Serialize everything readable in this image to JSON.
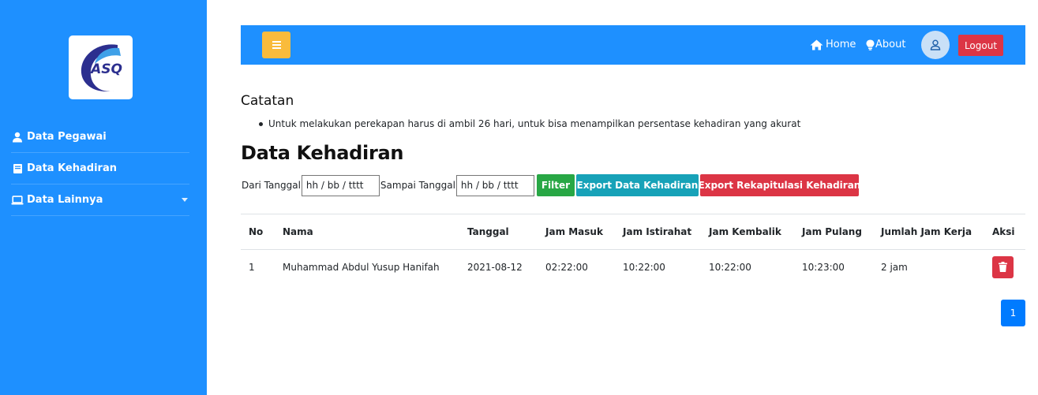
{
  "sidebar": {
    "logo_text": "ASQ",
    "items": [
      {
        "label": "Data Pegawai",
        "icon": "user-icon"
      },
      {
        "label": "Data Kehadiran",
        "icon": "book-icon"
      },
      {
        "label": "Data Lainnya",
        "icon": "laptop-icon"
      }
    ]
  },
  "navbar": {
    "home_label": "Home",
    "about_label": "About",
    "logout_label": "Logout"
  },
  "notes": {
    "title": "Catatan",
    "items": [
      "Untuk melakukan perekapan harus di ambil 26 hari, untuk bisa menampilkan persentase kehadiran yang akurat"
    ]
  },
  "page_title": "Data Kehadiran",
  "filter": {
    "from_label": "Dari Tanggal",
    "from_placeholder": "hh / bb / tttt",
    "to_label": "Sampai Tanggal",
    "to_placeholder": "hh / bb / tttt",
    "filter_button": "Filter",
    "export_button": "Export Data Kehadiran",
    "export_rekap_button": "Export Rekapitulasi Kehadiran"
  },
  "table": {
    "headers": [
      "No",
      "Nama",
      "Tanggal",
      "Jam Masuk",
      "Jam Istirahat",
      "Jam Kembalik",
      "Jam Pulang",
      "Jumlah Jam Kerja",
      "Aksi"
    ],
    "rows": [
      [
        "1",
        "Muhammad Abdul Yusup Hanifah",
        "2021-08-12",
        "02:22:00",
        "10:22:00",
        "10:22:00",
        "10:23:00",
        "2 jam"
      ]
    ]
  },
  "pagination": {
    "current_page": "1"
  },
  "colors": {
    "primary": "#1e90ff",
    "warning": "#f9bb3c",
    "success": "#28a745",
    "info": "#17a2b8",
    "danger": "#dc3545",
    "page_active": "#007bff"
  }
}
